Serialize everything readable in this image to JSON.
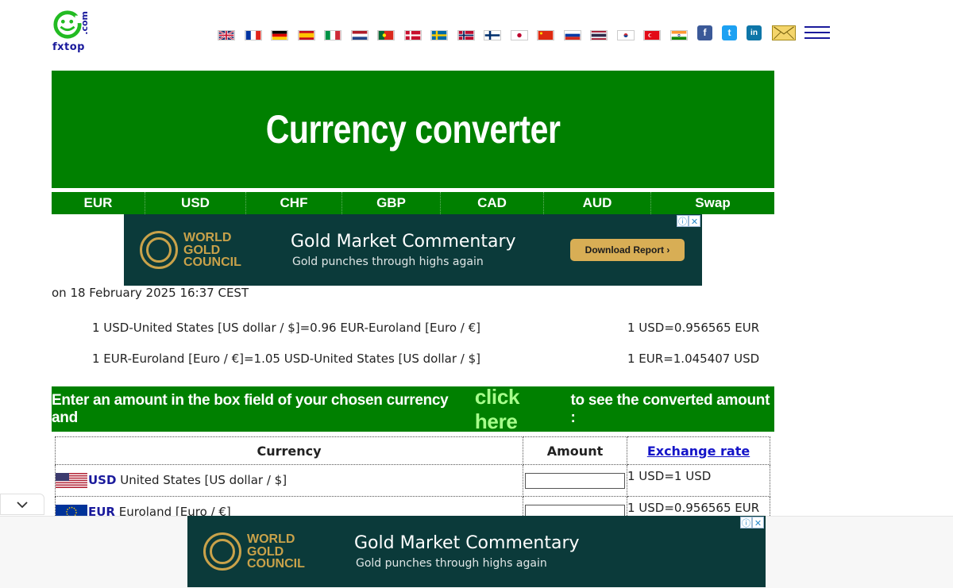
{
  "logo": {
    "text": "fxtop",
    "suffix": ".com"
  },
  "languages": [
    "English",
    "French",
    "German",
    "Spanish",
    "Italian",
    "Dutch",
    "Portuguese",
    "Danish",
    "Swedish",
    "Norwegian",
    "Finnish",
    "Japanese",
    "Chinese",
    "Russian",
    "Thai",
    "Korean",
    "Turkish",
    "Hindi"
  ],
  "social": {
    "facebook": "f",
    "twitter": "t",
    "linkedin": "in"
  },
  "title": "Currency converter",
  "tabs": [
    "EUR",
    "USD",
    "CHF",
    "GBP",
    "CAD",
    "AUD",
    "Swap"
  ],
  "ad": {
    "brand_line1": "WORLD",
    "brand_line2": "GOLD",
    "brand_line3": "COUNCIL",
    "headline": "Gold Market Commentary",
    "subline": "Gold punches through highs again",
    "cta": "Download Report ›",
    "info_icon": "ⓘ",
    "close_icon": "✕"
  },
  "date_line": "on 18 February 2025 16:37 CEST",
  "rates": [
    {
      "left": "1 USD-United States [US dollar / $]=0.96 EUR-Euroland [Euro / €]",
      "right": "1 USD=0.956565 EUR"
    },
    {
      "left": "1 EUR-Euroland [Euro / €]=1.05 USD-United States [US dollar / $]",
      "right": "1 EUR=1.045407 USD"
    }
  ],
  "instruction": {
    "before": "Enter an amount in the box field of your chosen currency and",
    "link": "click here",
    "after": "to see the converted amount :"
  },
  "table": {
    "headers": {
      "currency": "Currency",
      "amount": "Amount",
      "rate": "Exchange rate"
    },
    "rows": [
      {
        "code": "USD",
        "name": "United States [US dollar / $]",
        "rate": "1 USD=1 USD",
        "amount": ""
      },
      {
        "code": "EUR",
        "name": "Euroland [Euro / €]",
        "rate": "1 USD=0.956565 EUR",
        "amount": ""
      }
    ]
  },
  "colors": {
    "green": "#008000",
    "navy": "#1a1a9c",
    "ad_bg": "#0b3a3a",
    "gold": "#c9a24a"
  }
}
